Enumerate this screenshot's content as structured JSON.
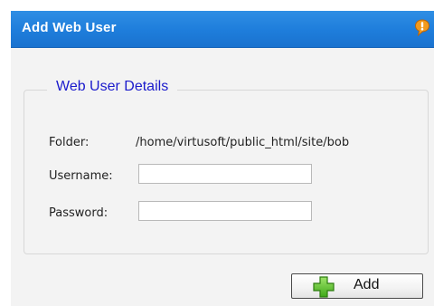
{
  "window": {
    "title": "Add Web User",
    "info_icon": "info-icon",
    "accent_color": "#1e7ddb"
  },
  "group": {
    "legend": "Web User Details"
  },
  "form": {
    "folder_label": "Folder:",
    "folder_value": "/home/virtusoft/public_html/site/bob",
    "username_label": "Username:",
    "username_value": "",
    "password_label": "Password:",
    "password_value": ""
  },
  "actions": {
    "add_label": "Add",
    "add_icon": "plus-icon"
  }
}
